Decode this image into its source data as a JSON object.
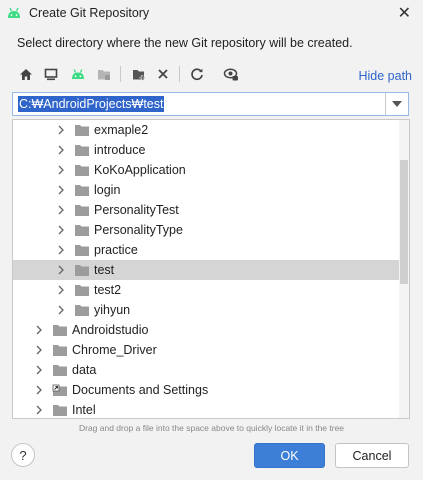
{
  "window": {
    "title": "Create Git Repository",
    "close_glyph": "✕"
  },
  "description": "Select directory where the new Git repository will be created.",
  "toolbar": {
    "icons": [
      "home-icon",
      "desktop-icon",
      "android-icon",
      "project-folder-icon",
      "new-folder-icon",
      "delete-icon",
      "refresh-icon",
      "show-hidden-icon"
    ],
    "hide_path_label": "Hide path"
  },
  "path": {
    "value": "C:₩AndroidProjects₩test"
  },
  "tree": {
    "rows": [
      {
        "label": "exmaple2",
        "level": 2,
        "selected": false
      },
      {
        "label": "introduce",
        "level": 2,
        "selected": false
      },
      {
        "label": "KoKoApplication",
        "level": 2,
        "selected": false
      },
      {
        "label": "login",
        "level": 2,
        "selected": false
      },
      {
        "label": "PersonalityTest",
        "level": 2,
        "selected": false
      },
      {
        "label": "PersonalityType",
        "level": 2,
        "selected": false
      },
      {
        "label": "practice",
        "level": 2,
        "selected": false
      },
      {
        "label": "test",
        "level": 2,
        "selected": true
      },
      {
        "label": "test2",
        "level": 2,
        "selected": false
      },
      {
        "label": "yihyun",
        "level": 2,
        "selected": false
      },
      {
        "label": "Androidstudio",
        "level": 1,
        "selected": false
      },
      {
        "label": "Chrome_Driver",
        "level": 1,
        "selected": false
      },
      {
        "label": "data",
        "level": 1,
        "selected": false
      },
      {
        "label": "Documents and Settings",
        "level": 1,
        "selected": false,
        "shortcut": true
      },
      {
        "label": "Intel",
        "level": 1,
        "selected": false
      }
    ]
  },
  "hint": "Drag and drop a file into the space above to quickly locate it in the tree",
  "buttons": {
    "help": "?",
    "ok": "OK",
    "cancel": "Cancel"
  },
  "colors": {
    "accent": "#3d7fd6",
    "link": "#2f65ca",
    "selection": "#d5d5d5",
    "android_green": "#3ddc84"
  }
}
